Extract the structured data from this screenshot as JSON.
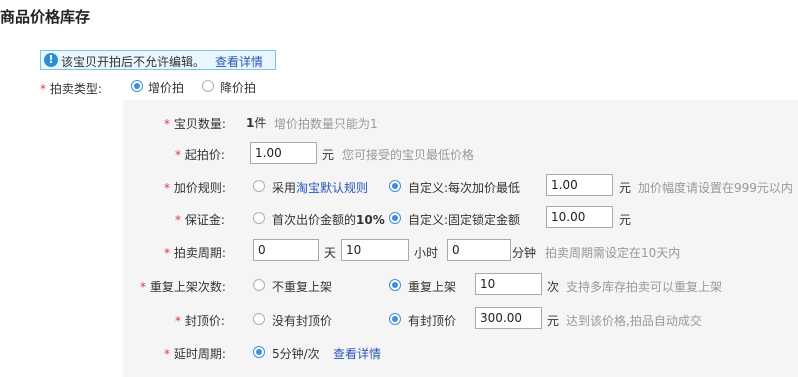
{
  "page": {
    "title": "商品价格库存"
  },
  "notice": {
    "text": "该宝贝开拍后不允许编辑。",
    "link": "查看详情"
  },
  "auction_type": {
    "label": "拍卖类型:",
    "options": [
      "增价拍",
      "降价拍"
    ],
    "selected": "增价拍"
  },
  "quantity": {
    "label": "宝贝数量:",
    "value": "1",
    "unit": "件",
    "hint": "增价拍数量只能为1"
  },
  "start_price": {
    "label": "起拍价:",
    "value": "1.00",
    "unit": "元",
    "hint": "您可接受的宝贝最低价格"
  },
  "increment": {
    "label": "加价规则:",
    "opt1_prefix": "采用",
    "opt1_link": "淘宝默认规则",
    "opt2": "自定义:每次加价最低",
    "value": "1.00",
    "unit": "元",
    "hint": "加价幅度请设置在999元以内",
    "selected": "custom"
  },
  "deposit": {
    "label": "保证金:",
    "opt1_prefix": "首次出价金额的",
    "opt1_bold": "10%",
    "opt2": "自定义:固定锁定金额",
    "value": "10.00",
    "unit": "元",
    "selected": "custom"
  },
  "period": {
    "label": "拍卖周期:",
    "days": "0",
    "days_unit": "天",
    "hours": "10",
    "hours_unit": "小时",
    "minutes": "0",
    "minutes_unit": "分钟",
    "hint": "拍卖周期需设定在10天内"
  },
  "relist": {
    "label": "重复上架次数:",
    "opt1": "不重复上架",
    "opt2": "重复上架",
    "value": "10",
    "unit": "次",
    "hint": "支持多库存拍卖可以重复上架",
    "selected": "relist"
  },
  "cap": {
    "label": "封顶价:",
    "opt1": "没有封顶价",
    "opt2": "有封顶价",
    "value": "300.00",
    "unit": "元",
    "hint": "达到该价格,拍品自动成交",
    "selected": "cap"
  },
  "delay": {
    "label": "延时周期:",
    "option": "5分钟/次",
    "link": "查看详情"
  },
  "colors": {
    "required": "#e4393c",
    "link": "#2a55b8",
    "radio_active": "#3b8fde",
    "hint": "#999999"
  }
}
